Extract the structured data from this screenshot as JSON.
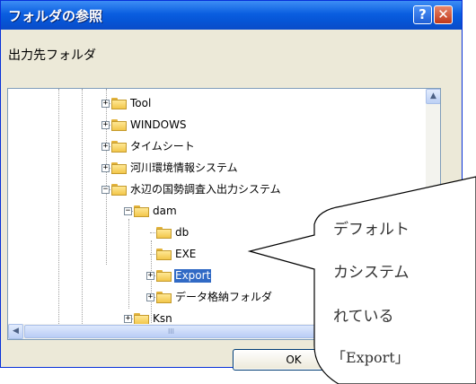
{
  "window": {
    "title": "フォルダの参照",
    "help_label": "?",
    "close_label": "✕"
  },
  "dialog": {
    "description": "出力先フォルダ",
    "ok_label": "OK"
  },
  "tree": {
    "items": [
      {
        "label": "Tool",
        "icon": "folder-icon",
        "expander": "+"
      },
      {
        "label": "WINDOWS",
        "icon": "folder-icon",
        "expander": "+"
      },
      {
        "label": "タイムシート",
        "icon": "folder-icon",
        "expander": "+"
      },
      {
        "label": "河川環境情報システム",
        "icon": "folder-icon",
        "expander": "+"
      },
      {
        "label": "水辺の国勢調査入出力システム",
        "icon": "folder-icon",
        "expander": "−"
      },
      {
        "label": "dam",
        "icon": "folder-icon",
        "expander": "−"
      },
      {
        "label": "db",
        "icon": "folder-icon"
      },
      {
        "label": "EXE",
        "icon": "folder-icon"
      },
      {
        "label": "Export",
        "icon": "folder-icon",
        "expander": "+",
        "selected": true
      },
      {
        "label": "データ格納フォルダ",
        "icon": "folder-icon",
        "expander": "+"
      },
      {
        "label": "Ksn",
        "icon": "folder-icon",
        "expander": "+"
      }
    ]
  },
  "scrollbars": {
    "up_arrow": "▲",
    "left_arrow": "◀",
    "grip": "III"
  },
  "callout": {
    "lines": [
      "デフォルト",
      "カシステム",
      "れている",
      "「Export」"
    ]
  },
  "colors": {
    "titlebar": "#0a5ee0",
    "selection": "#316ac5",
    "dialog_bg": "#ece9d8"
  }
}
